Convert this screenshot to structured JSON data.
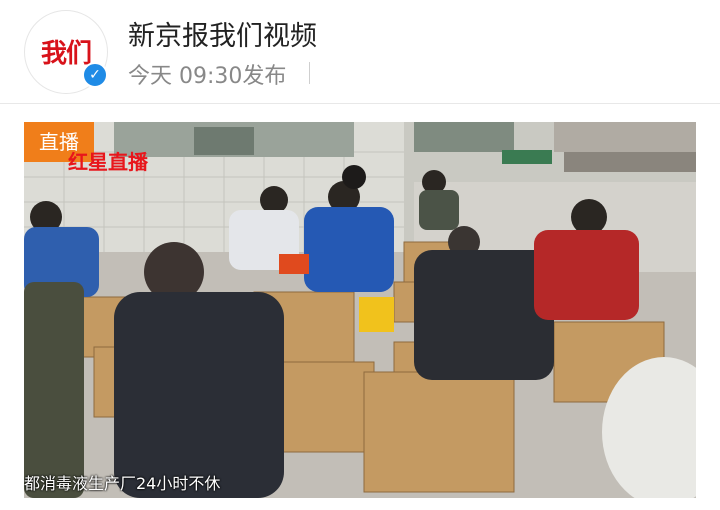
{
  "account": {
    "logo_text": "我们",
    "name": "新京报我们视频",
    "post_time": "今天 09:30发布",
    "verified_icon": "verified-check-icon"
  },
  "video": {
    "live_badge": "直播",
    "watermark": "红星直播",
    "caption": "都消毒液生产厂24小时不休"
  },
  "colors": {
    "accent_orange": "#f07e1a",
    "watermark_red": "#e8161c",
    "verified_blue": "#1f8be6"
  }
}
